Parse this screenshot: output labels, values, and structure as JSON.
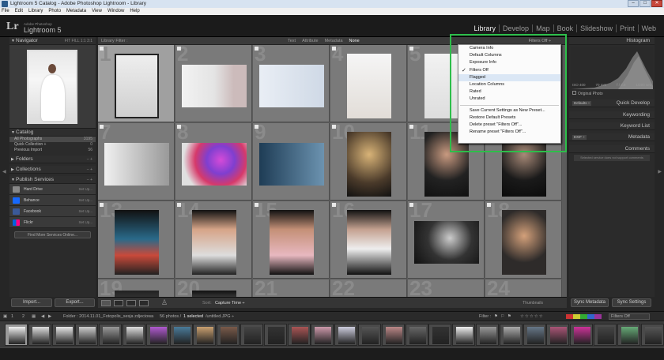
{
  "window": {
    "title": "Lightroom 5 Catalog - Adobe Photoshop Lightroom - Library",
    "btn_min": "‒",
    "btn_max": "□",
    "btn_close": "✕"
  },
  "menu": [
    "File",
    "Edit",
    "Library",
    "Photo",
    "Metadata",
    "View",
    "Window",
    "Help"
  ],
  "brand": {
    "small": "Adobe Photoshop",
    "name": "Lightroom 5",
    "logo": "Lr"
  },
  "modules": [
    "Library",
    "Develop",
    "Map",
    "Book",
    "Slideshow",
    "Print",
    "Web"
  ],
  "left": {
    "navigator": {
      "title": "Navigator",
      "extra": "FIT  FILL  1:1  3:1"
    },
    "catalog": {
      "title": "Catalog",
      "items": [
        {
          "label": "All Photographs",
          "count": "3195"
        },
        {
          "label": "Quick Collection +",
          "count": "0"
        },
        {
          "label": "Previous Import",
          "count": "56"
        }
      ]
    },
    "folders": "Folders",
    "collections": "Collections",
    "publish": {
      "title": "Publish Services",
      "items": [
        {
          "label": "Hard Drive",
          "set": "Set Up..."
        },
        {
          "label": "Behance",
          "set": "Set Up..."
        },
        {
          "label": "Facebook",
          "set": "Set Up..."
        },
        {
          "label": "Flickr",
          "set": "Set Up..."
        }
      ],
      "find_more": "Find More Services Online..."
    },
    "import": "Import...",
    "export": "Export..."
  },
  "filterbar": {
    "title": "Library Filter :",
    "tabs": [
      "Text",
      "Attribute",
      "Metadata",
      "None"
    ],
    "active": "None",
    "preset": "Filters Off ÷"
  },
  "grid_menu": [
    {
      "label": "Camera Info",
      "checked": false
    },
    {
      "label": "Default Columns",
      "checked": false
    },
    {
      "label": "Exposure Info",
      "checked": false
    },
    {
      "label": "Filters Off",
      "checked": true
    },
    {
      "label": "Flagged",
      "checked": false,
      "highlight": true
    },
    {
      "label": "Location Columns",
      "checked": false
    },
    {
      "label": "Rated",
      "checked": false
    },
    {
      "label": "Unrated",
      "checked": false
    },
    {
      "sep": true
    },
    {
      "label": "Save Current Settings as New Preset...",
      "checked": false
    },
    {
      "label": "Restore Default Presets",
      "checked": false
    },
    {
      "label": "Delete preset \"Filters Off\"...",
      "checked": false
    },
    {
      "label": "Rename preset \"Filters Off\"...",
      "checked": false
    }
  ],
  "grid_numbers": [
    1,
    2,
    3,
    4,
    5,
    6,
    7,
    8,
    9,
    10,
    11,
    12,
    13,
    14,
    15,
    16,
    17,
    18,
    19,
    20,
    21,
    22,
    23,
    24
  ],
  "toolbar": {
    "sort_label": "Sort:",
    "sort_value": "Capture Time ÷",
    "thumbnails": "Thumbnails"
  },
  "right": {
    "histogram": "Histogram",
    "hist_values": [
      "ISO 400",
      "70 mm",
      "f / 2.8",
      "1/200 sec"
    ],
    "original_photo": "Original Photo",
    "defaults": "Defaults ÷",
    "quick_develop": "Quick Develop",
    "keywording": "Keywording",
    "keyword_list": "Keyword List",
    "metadata": "Metadata",
    "metadata_preset": "EXIF ÷",
    "comments": "Comments",
    "comments_note": "Selected service does not support comments",
    "sync_metadata": "Sync Metadata",
    "sync_settings": "Sync Settings"
  },
  "filmbar": {
    "nav_num1": "1",
    "nav_num2": "2",
    "folder_text": "Folder : 2014.11.01_Fotopolis_sesja zdjeciowa",
    "count_text": "56 photos /",
    "selected": "1 selected",
    "file": "/untitled.JPG ÷",
    "filter_label": "Filter :",
    "filter_preset": "Filters Off"
  }
}
